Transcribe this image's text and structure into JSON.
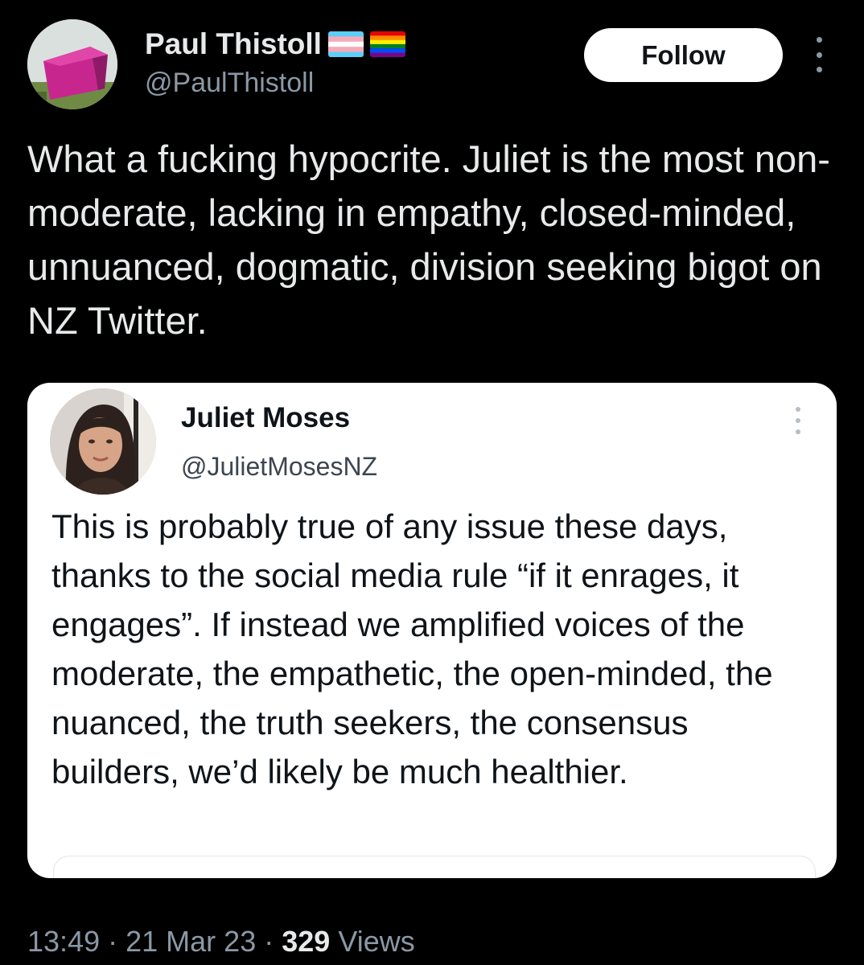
{
  "tweet": {
    "author": {
      "name": "Paul Thistoll",
      "handle": "@PaulThistoll",
      "flags": [
        "transgender-flag-icon",
        "rainbow-flag-icon"
      ]
    },
    "follow_label": "Follow",
    "text": "What a fucking hypocrite. Juliet is the most non-moderate, lacking in empathy, closed-minded, unnuanced, dogmatic, division seeking bigot on NZ Twitter.",
    "quoted": {
      "name": "Juliet Moses",
      "handle": "@JulietMosesNZ",
      "text": "This is probably true of any issue these days, thanks to the social media rule “if it enrages, it engages”. If instead we amplified voices of the moderate, the empathetic, the open-minded, the nuanced, the truth seekers, the consensus builders, we’d likely be much healthier."
    },
    "meta": {
      "time": "13:49",
      "separator": "·",
      "date": "21 Mar 23",
      "views_count": "329",
      "views_label": "Views"
    }
  },
  "colors": {
    "background": "#000000",
    "text_primary": "#e7e9ea",
    "text_secondary": "#8b98a5",
    "follow_bg": "#ffffff",
    "card_bg": "#ffffff"
  }
}
